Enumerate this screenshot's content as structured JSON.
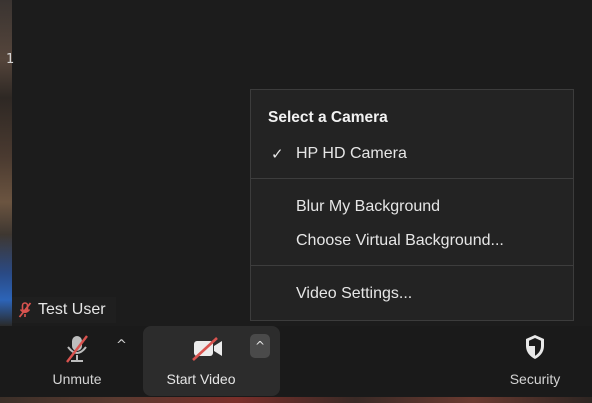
{
  "video": {
    "edge_mark": "1"
  },
  "participant": {
    "name": "Test User",
    "mic_state_icon": "mic-muted-icon"
  },
  "camera_menu": {
    "heading": "Select a Camera",
    "selected_check": "✓",
    "cameras": [
      {
        "label": "HP HD Camera",
        "selected": true
      }
    ],
    "background_options": [
      {
        "label": "Blur My Background"
      },
      {
        "label": "Choose Virtual Background..."
      }
    ],
    "settings_label": "Video Settings..."
  },
  "toolbar": {
    "unmute_label": "Unmute",
    "unmute_caret": "^",
    "start_video_label": "Start Video",
    "video_caret": "^",
    "security_label": "Security"
  },
  "colors": {
    "background": "#1c1c1c",
    "menu_background": "#232323",
    "muted_red": "#d9534f",
    "text": "#e6e6e6"
  }
}
